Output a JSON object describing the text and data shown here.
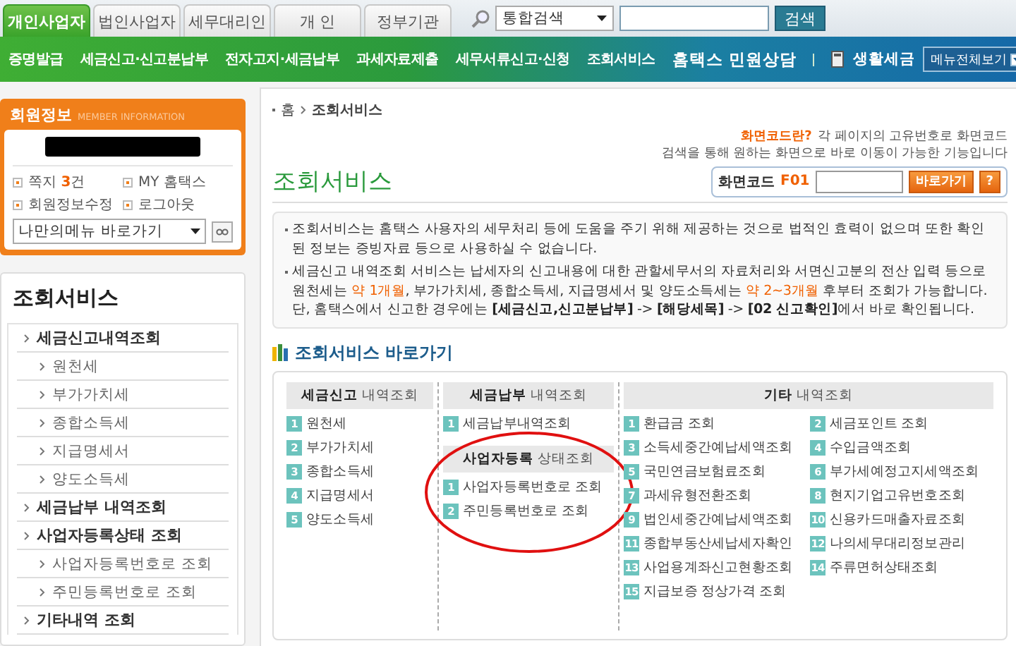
{
  "tabs": [
    {
      "label": "개인사업자",
      "selected": true
    },
    {
      "label": "법인사업자",
      "selected": false
    },
    {
      "label": "세무대리인",
      "selected": false
    },
    {
      "label": "개 인",
      "selected": false
    },
    {
      "label": "정부기관",
      "selected": false
    }
  ],
  "search": {
    "scope": "통합검색",
    "button": "검색"
  },
  "nav": {
    "links": [
      "증명발급",
      "세금신고·신고분납부",
      "전자고지·세금납부",
      "과세자료제출",
      "세무서류신고·신청",
      "조회서비스"
    ],
    "counsel": "홈택스 민원상담",
    "life_tax": "생활세금",
    "all_menu": "메뉴전체보기"
  },
  "member": {
    "title": "회원정보",
    "subtitle": "MEMBER INFORMATION",
    "links": [
      "쪽지 **3**건",
      "MY 홈택스",
      "회원정보수정",
      "로그아웃"
    ],
    "my_menu": "나만의메뉴 바로가기"
  },
  "sidebar": {
    "title": "조회서비스",
    "items": [
      {
        "label": "세금신고내역조회",
        "children": [
          {
            "label": "원천세"
          },
          {
            "label": "부가가치세"
          },
          {
            "label": "종합소득세"
          },
          {
            "label": "지급명세서"
          },
          {
            "label": "양도소득세"
          }
        ]
      },
      {
        "label": "세금납부 내역조회"
      },
      {
        "label": "사업자등록상태 조회",
        "children": [
          {
            "label": "사업자등록번호로 조회"
          },
          {
            "label": "주민등록번호로 조회"
          }
        ]
      },
      {
        "label": "기타내역 조회"
      }
    ]
  },
  "breadcrumb": [
    "홈",
    "조회서비스"
  ],
  "code_help": {
    "link": "화면코드란?",
    "lines": [
      "각 페이지의 고유번호로 화면코드",
      "검색을 통해 원하는 화면으로 바로 이동이 가능한 기능입니다"
    ]
  },
  "page_title": "조회서비스",
  "screen_code": {
    "label": "화면코드",
    "code": "F01",
    "button": "바로가기",
    "help_button": "?"
  },
  "notice": [
    {
      "lines": [
        "조회서비스는 홈택스 사용자의 세무처리 등에 도움을 주기 위해 제공하는 것으로 법적인 효력이 없으며 또한 확인된 정보는 증빙자료 등으로 사용하실 수 없습니다."
      ]
    },
    {
      "lines": [
        "세금신고 내역조회 서비스는 납세자의 신고내용에 대한 관할세무서의 자료처리와 서면신고분의 전산 입력 등으로 원천세는 *약 1개월*, 부가가치세, 종합소득세, 지급명세서 및 양도소득세는 *약 2~3개월* 후부터 조회가 가능합니다.",
        "단, 홈택스에서 신고한 경우에는 **[세금신고,신고분납부]** -> **[해당세목]** -> **[02 신고확인]**에서 바로 확인됩니다."
      ]
    }
  ],
  "quick": {
    "title": "조회서비스 바로가기",
    "columns": [
      {
        "kind": "list",
        "groups": [
          {
            "title": "**세금신고** 내역조회",
            "items": [
              {
                "no": "1",
                "label": "원천세"
              },
              {
                "no": "2",
                "label": "부가가치세"
              },
              {
                "no": "3",
                "label": "종합소득세"
              },
              {
                "no": "4",
                "label": "지급명세서"
              },
              {
                "no": "5",
                "label": "양도소득세"
              }
            ]
          }
        ]
      },
      {
        "kind": "list",
        "groups": [
          {
            "title": "**세금납부** 내역조회",
            "items": [
              {
                "no": "1",
                "label": "세금납부내역조회"
              }
            ]
          },
          {
            "title": "**사업자등록** 상태조회",
            "circled": true,
            "items": [
              {
                "no": "1",
                "label": "사업자등록번호로 조회"
              },
              {
                "no": "2",
                "label": "주민등록번호로 조회"
              }
            ]
          }
        ]
      },
      {
        "kind": "grid",
        "groups": [
          {
            "title": "**기타** 내역조회",
            "items": [
              {
                "no": "1",
                "label": "환급금 조회"
              },
              {
                "no": "2",
                "label": "세금포인트 조회"
              },
              {
                "no": "3",
                "label": "소득세중간예납세액조회"
              },
              {
                "no": "4",
                "label": "수입금액조회"
              },
              {
                "no": "5",
                "label": "국민연금보험료조회"
              },
              {
                "no": "6",
                "label": "부가세예정고지세액조회"
              },
              {
                "no": "7",
                "label": "과세유형전환조회"
              },
              {
                "no": "8",
                "label": "현지기업고유번호조회"
              },
              {
                "no": "9",
                "label": "법인세중간예납세액조회"
              },
              {
                "no": "10",
                "label": "신용카드매출자료조회"
              },
              {
                "no": "11",
                "label": "종합부동산세납세자확인"
              },
              {
                "no": "12",
                "label": "나의세무대리정보관리"
              },
              {
                "no": "13",
                "label": "사업용계좌신고현황조회"
              },
              {
                "no": "14",
                "label": "주류면허상태조회"
              },
              {
                "no": "15",
                "label": "지급보증 정상가격 조회"
              }
            ]
          }
        ]
      }
    ]
  }
}
